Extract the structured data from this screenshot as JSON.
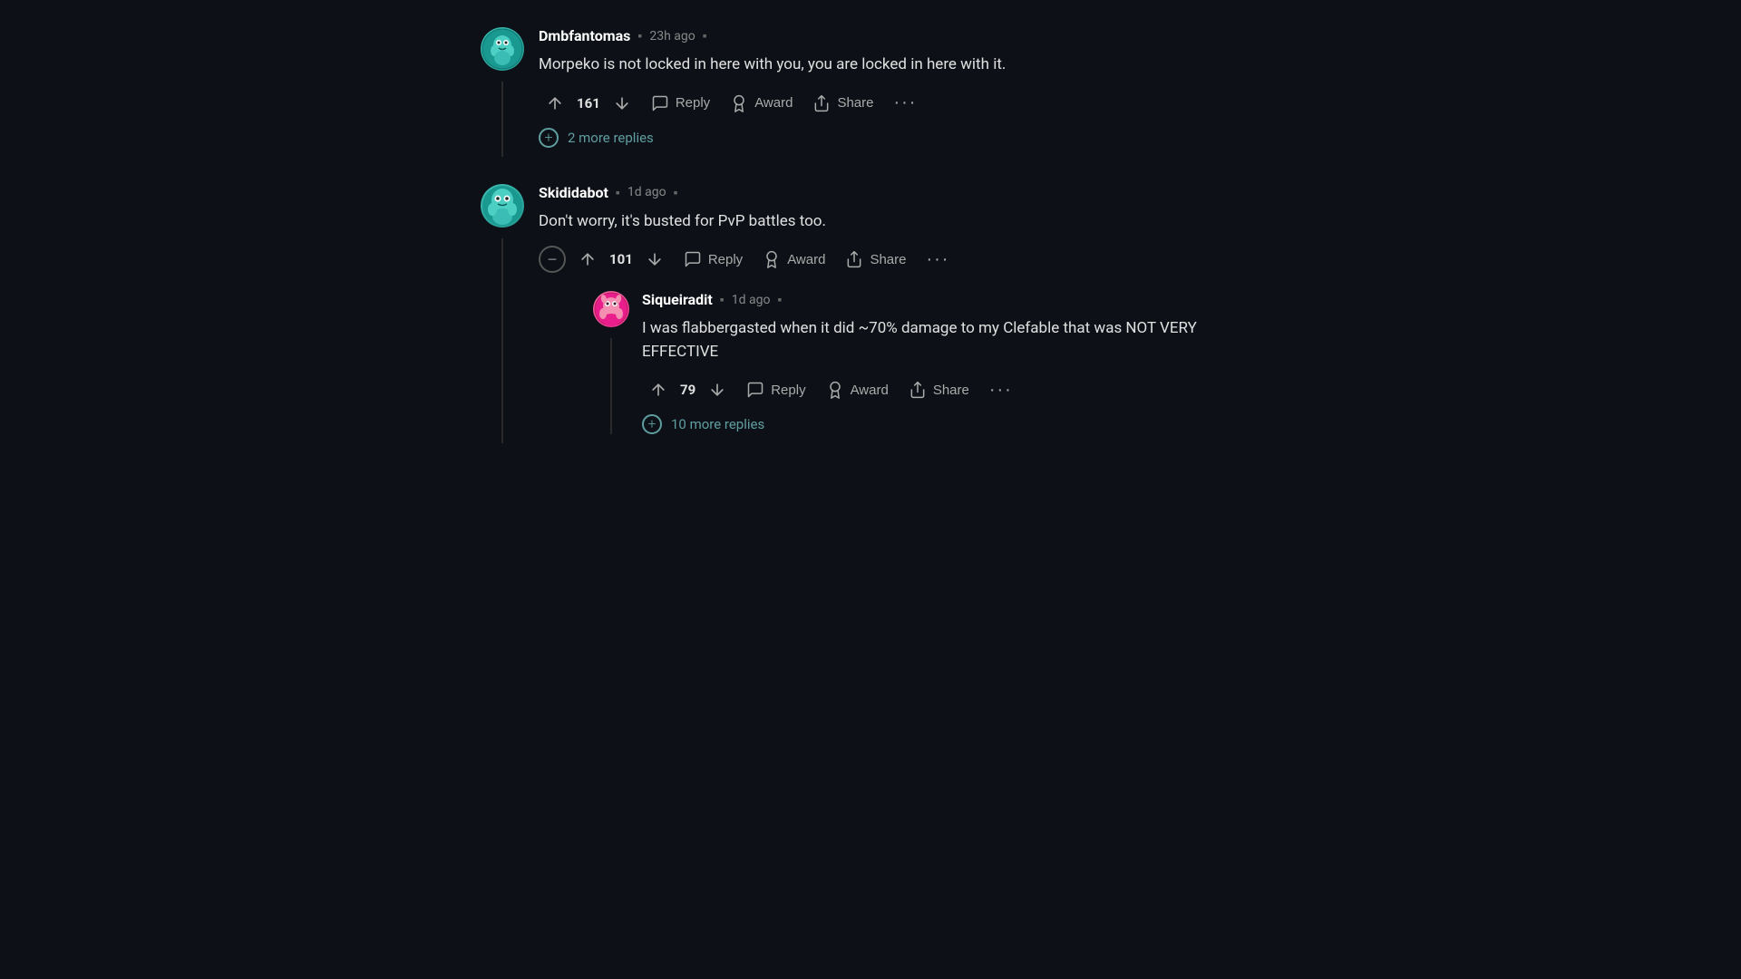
{
  "comments": [
    {
      "id": "comment1",
      "username": "Dmbfantomas",
      "timestamp": "23h ago",
      "text": "Morpeko is not locked in here with you, you are locked in here with it.",
      "upvotes": "161",
      "hasThreadLine": true,
      "moreReplies": "2 more replies",
      "actions": {
        "reply": "Reply",
        "award": "Award",
        "share": "Share"
      }
    },
    {
      "id": "comment2",
      "username": "Skididabot",
      "timestamp": "1d ago",
      "text": "Don't worry, it's busted for PvP battles too.",
      "upvotes": "101",
      "hasThreadLine": true,
      "actions": {
        "reply": "Reply",
        "award": "Award",
        "share": "Share"
      },
      "nested": {
        "id": "nested1",
        "username": "Siqueiradit",
        "timestamp": "1d ago",
        "text": "I was flabbergasted when it did ~70% damage to my Clefable that was NOT VERY EFFECTIVE",
        "upvotes": "79",
        "moreReplies": "10 more replies",
        "actions": {
          "reply": "Reply",
          "award": "Award",
          "share": "Share"
        }
      }
    }
  ],
  "icons": {
    "upvote": "upvote-icon",
    "downvote": "downvote-icon",
    "reply": "reply-icon",
    "award": "award-icon",
    "share": "share-icon",
    "more": "more-icon",
    "plus": "plus-icon",
    "minus": "minus-icon"
  }
}
